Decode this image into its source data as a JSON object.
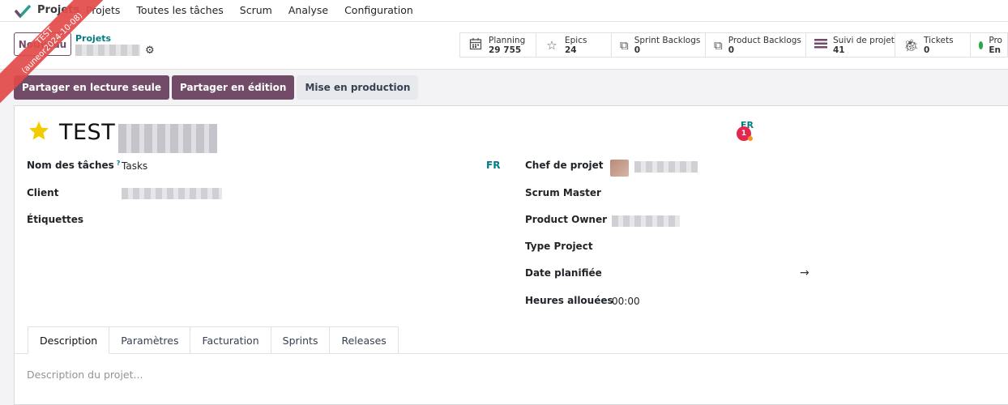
{
  "app": {
    "name": "Projets",
    "logo_icon": "odoo-project-check-icon"
  },
  "menu": [
    "Projets",
    "Toutes les tâches",
    "Scrum",
    "Analyse",
    "Configuration"
  ],
  "ribbon": {
    "line1": "TEST",
    "line2": "(auneor2024-10-08)"
  },
  "control_panel": {
    "new_button": "Nouveau",
    "breadcrumb_parent": "Projets",
    "stats": [
      {
        "icon": "calendar-icon",
        "label": "Planning",
        "value": "29 755"
      },
      {
        "icon": "star-outline-icon",
        "label": "Epics",
        "value": "24"
      },
      {
        "icon": "copy-icon",
        "label": "Sprint Backlogs",
        "value": "0"
      },
      {
        "icon": "copy-icon",
        "label": "Product Backlogs",
        "value": "0"
      },
      {
        "icon": "list-icon",
        "label": "Suivi de projet",
        "value": "41"
      },
      {
        "icon": "bug-icon",
        "label": "Tickets",
        "value": "0"
      },
      {
        "icon": "status-dot-icon",
        "label": "Pro",
        "value": "En"
      }
    ]
  },
  "actions": [
    "Partager en lecture seule",
    "Partager en édition",
    "Mise en production"
  ],
  "form": {
    "title": "TEST",
    "lang_top": "FR",
    "badge_count": "1",
    "left": {
      "task_name_label": "Nom des tâches",
      "task_name_help": "?",
      "task_name_value": "Tasks",
      "lang": "FR",
      "client_label": "Client",
      "tags_label": "Étiquettes"
    },
    "right": {
      "manager_label": "Chef de projet",
      "scrum_master_label": "Scrum Master",
      "product_owner_label": "Product Owner",
      "type_label": "Type Project",
      "date_label": "Date planifiée",
      "date_arrow": "→",
      "hours_label": "Heures allouées",
      "hours_value": "00:00"
    },
    "tabs": [
      "Description",
      "Paramètres",
      "Facturation",
      "Sprints",
      "Releases"
    ],
    "active_tab": "Description",
    "description_placeholder": "Description du projet..."
  },
  "colors": {
    "brand": "#714b67",
    "accent": "#017e84",
    "badge": "#e3284f"
  }
}
